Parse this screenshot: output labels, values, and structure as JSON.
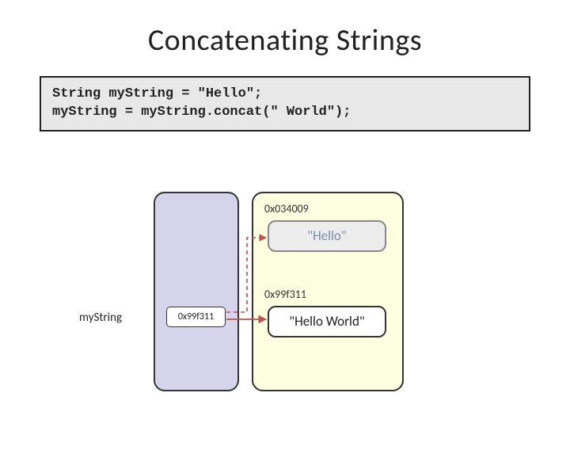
{
  "title": "Concatenating Strings",
  "code": "String myString = \"Hello\";\nmyString = myString.concat(\" World\");",
  "stack": {
    "variable": {
      "name": "myString",
      "value": "0x99f311"
    }
  },
  "heap": {
    "items": [
      {
        "address": "0x034009",
        "content": "\"Hello\"",
        "state": "old"
      },
      {
        "address": "0x99f311",
        "content": "\"Hello World\"",
        "state": "new"
      }
    ]
  }
}
